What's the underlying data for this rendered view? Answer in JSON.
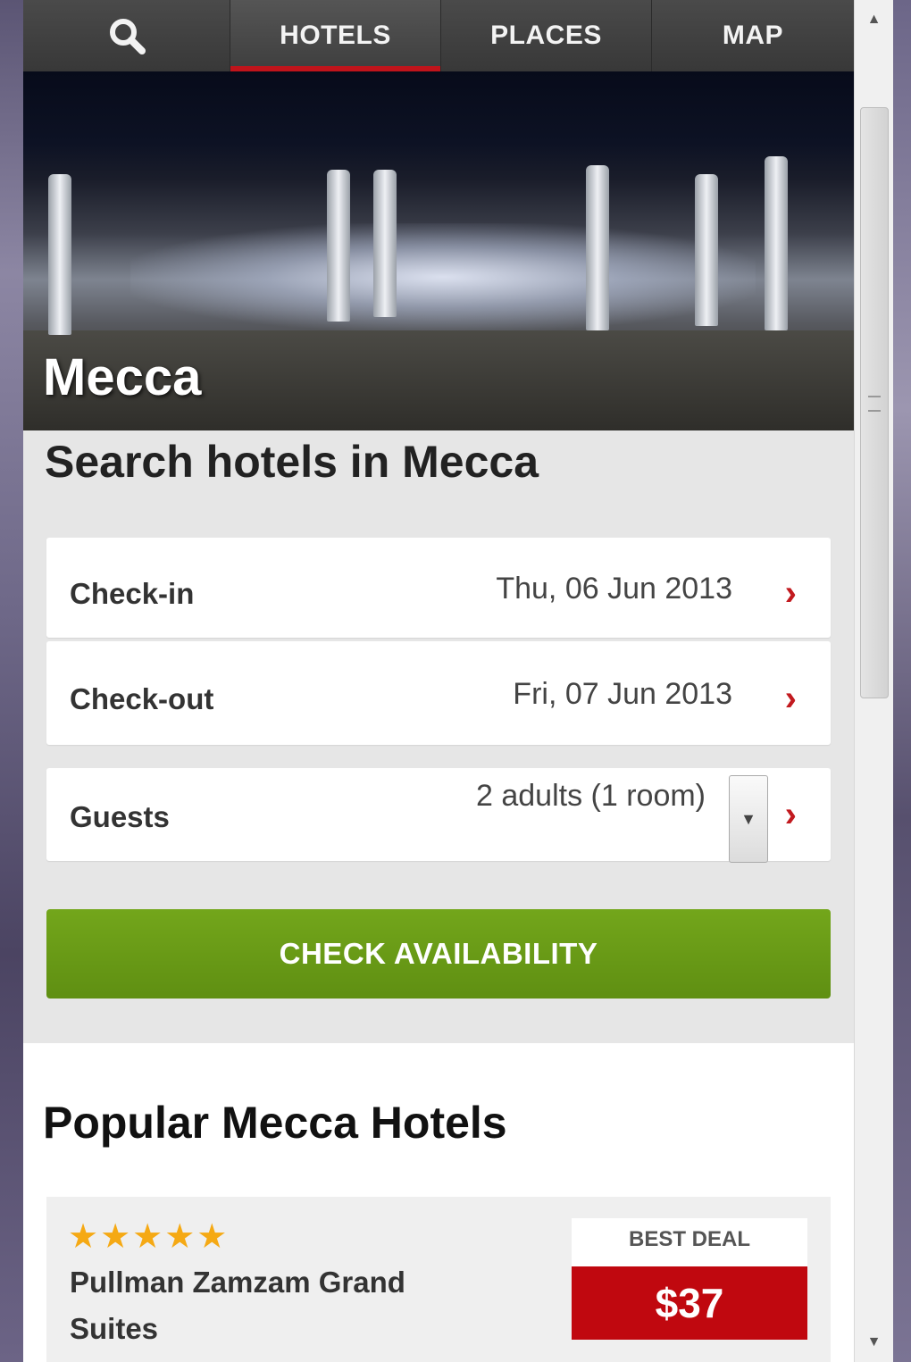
{
  "nav": {
    "search_icon": "search-icon",
    "tabs": [
      {
        "label": "HOTELS",
        "active": true
      },
      {
        "label": "PLACES",
        "active": false
      },
      {
        "label": "MAP",
        "active": false
      }
    ],
    "accent_color": "#c0141b"
  },
  "hero": {
    "city": "Mecca"
  },
  "search": {
    "title": "Search hotels in Mecca",
    "checkin": {
      "label": "Check-in",
      "value": "Thu, 06 Jun 2013"
    },
    "checkout": {
      "label": "Check-out",
      "value": "Fri, 07 Jun 2013"
    },
    "guests": {
      "label": "Guests",
      "value": "2 adults (1 room)"
    },
    "cta_label": "CHECK AVAILABILITY",
    "cta_color": "#6a9c16"
  },
  "popular": {
    "title": "Popular Mecca Hotels",
    "hotels": [
      {
        "stars": "★★★★★",
        "star_count": 5,
        "name": "Pullman Zamzam Grand Suites",
        "deal_label": "BEST DEAL",
        "price": "$37",
        "price_color": "#c0080f"
      }
    ]
  }
}
